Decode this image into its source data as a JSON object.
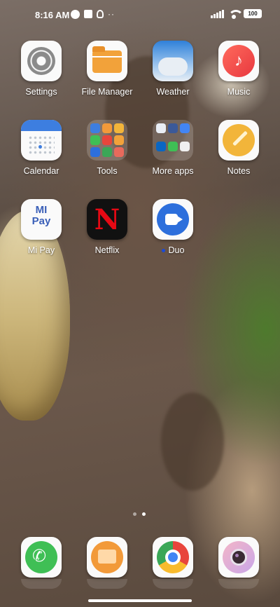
{
  "status_bar": {
    "time": "8:16 AM",
    "more_indicator": "··",
    "battery": "100"
  },
  "apps": {
    "row1": [
      {
        "label": "Settings",
        "icon": "gear-icon"
      },
      {
        "label": "File Manager",
        "icon": "folder-icon"
      },
      {
        "label": "Weather",
        "icon": "cloud-icon"
      },
      {
        "label": "Music",
        "icon": "music-note-icon"
      }
    ],
    "row2": [
      {
        "label": "Calendar",
        "icon": "calendar-icon"
      },
      {
        "label": "Tools",
        "icon": "app-folder-icon"
      },
      {
        "label": "More apps",
        "icon": "app-folder-icon"
      },
      {
        "label": "Notes",
        "icon": "pen-icon"
      }
    ],
    "row3": [
      {
        "label": "Mi Pay",
        "icon": "mi-pay-icon",
        "logo_text": "MI\nPay"
      },
      {
        "label": "Netflix",
        "icon": "netflix-icon",
        "logo_text": "N"
      },
      {
        "label": "Duo",
        "icon": "video-camera-icon",
        "new_badge": true
      }
    ]
  },
  "dock": [
    {
      "name": "phone",
      "icon": "phone-handset-icon"
    },
    {
      "name": "messages",
      "icon": "message-bubble-icon"
    },
    {
      "name": "chrome",
      "icon": "chrome-icon"
    },
    {
      "name": "camera",
      "icon": "camera-lens-icon"
    }
  ],
  "page_indicator": {
    "count": 2,
    "active_index": 1
  },
  "colors": {
    "label_text": "#ffffff",
    "netflix_red": "#e50914",
    "duo_blue": "#2d6fdc",
    "phone_green": "#3fbf55"
  }
}
